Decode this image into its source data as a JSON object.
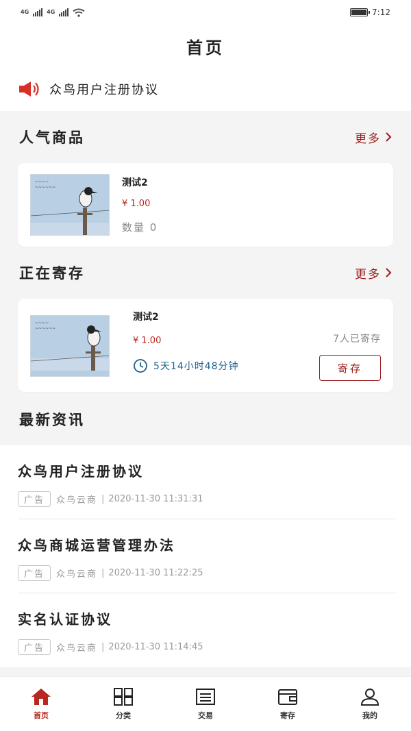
{
  "status_bar": {
    "network_1": "4G",
    "network_2": "4G",
    "time": "7:12"
  },
  "header": {
    "title": "首页"
  },
  "notice": {
    "text": "众鸟用户注册协议"
  },
  "hot_products": {
    "title": "人气商品",
    "more_label": "更多",
    "items": [
      {
        "name": "测试2",
        "price": "¥ 1.00",
        "quantity": "数量 0"
      }
    ]
  },
  "storage": {
    "title": "正在寄存",
    "more_label": "更多",
    "items": [
      {
        "name": "测试2",
        "price": "¥ 1.00",
        "countdown": "5天14小时48分钟",
        "people": "7人已寄存",
        "button_label": "寄存"
      }
    ]
  },
  "news": {
    "title": "最新资讯",
    "items": [
      {
        "title": "众鸟用户注册协议",
        "tag": "广告",
        "source": "众鸟云商",
        "time": "2020-11-30 11:31:31"
      },
      {
        "title": "众鸟商城运营管理办法",
        "tag": "广告",
        "source": "众鸟云商",
        "time": "2020-11-30 11:22:25"
      },
      {
        "title": "实名认证协议",
        "tag": "广告",
        "source": "众鸟云商",
        "time": "2020-11-30 11:14:45"
      }
    ]
  },
  "bottom_nav": {
    "items": [
      {
        "label": "首页",
        "icon": "home-icon",
        "active": true
      },
      {
        "label": "分类",
        "icon": "grid-icon",
        "active": false
      },
      {
        "label": "交易",
        "icon": "list-icon",
        "active": false
      },
      {
        "label": "寄存",
        "icon": "wallet-icon",
        "active": false
      },
      {
        "label": "我的",
        "icon": "user-icon",
        "active": false
      }
    ]
  },
  "colors": {
    "accent": "#9b1b1b",
    "price": "#b8281e",
    "timer": "#1e5f8c"
  }
}
